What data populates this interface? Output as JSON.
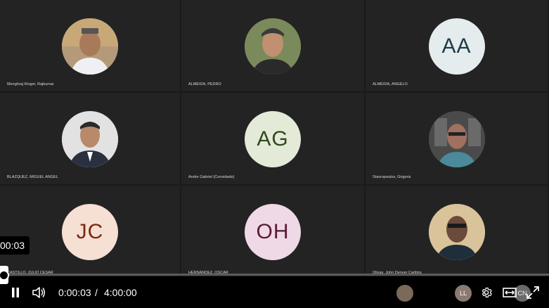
{
  "participants": [
    {
      "name": "Menghraj Kinger, Rajkumar",
      "initials": "",
      "bg": "#c9b8a8"
    },
    {
      "name": "ALMEIDA, PEDRO",
      "initials": "",
      "bg": "#6a7a4a"
    },
    {
      "name": "ALMEIDA, ANGELO",
      "initials": "AA",
      "bg": "#e4ecee",
      "fg": "#1e3a46"
    },
    {
      "name": "BLAZQUEZ, MIGUEL ANGEL",
      "initials": "",
      "bg": "#dddddd"
    },
    {
      "name": "Andre Gabriel (Convidado)",
      "initials": "AG",
      "bg": "#e3ead8",
      "fg": "#2f4a1e"
    },
    {
      "name": "Stavropoulos, Grigoris",
      "initials": "",
      "bg": "#5a5a5a"
    },
    {
      "name": "CASTILLO, JULIO CESAR",
      "initials": "JC",
      "bg": "#f6dfd3",
      "fg": "#7a2a10"
    },
    {
      "name": "HERNANDEZ, OSCAR",
      "initials": "OH",
      "bg": "#efd9e6",
      "fg": "#5a1a3a"
    },
    {
      "name": "Olivas, John Denver Carlitos",
      "initials": "",
      "bg": "#d8c49a"
    }
  ],
  "player": {
    "tooltip": "00:03",
    "current_time": "0:00:03",
    "separator": "/",
    "duration": "4:00:00",
    "progress": 0.0002
  },
  "dock": [
    {
      "initials": "LL",
      "bg": "#8a7a70"
    },
    {
      "initials": "CN",
      "bg": "#6a6a6a"
    }
  ],
  "icons": {
    "pause": "pause-icon",
    "volume": "volume-icon",
    "settings": "gear-icon",
    "theater": "theater-mode-icon",
    "fullscreen": "fullscreen-icon"
  }
}
